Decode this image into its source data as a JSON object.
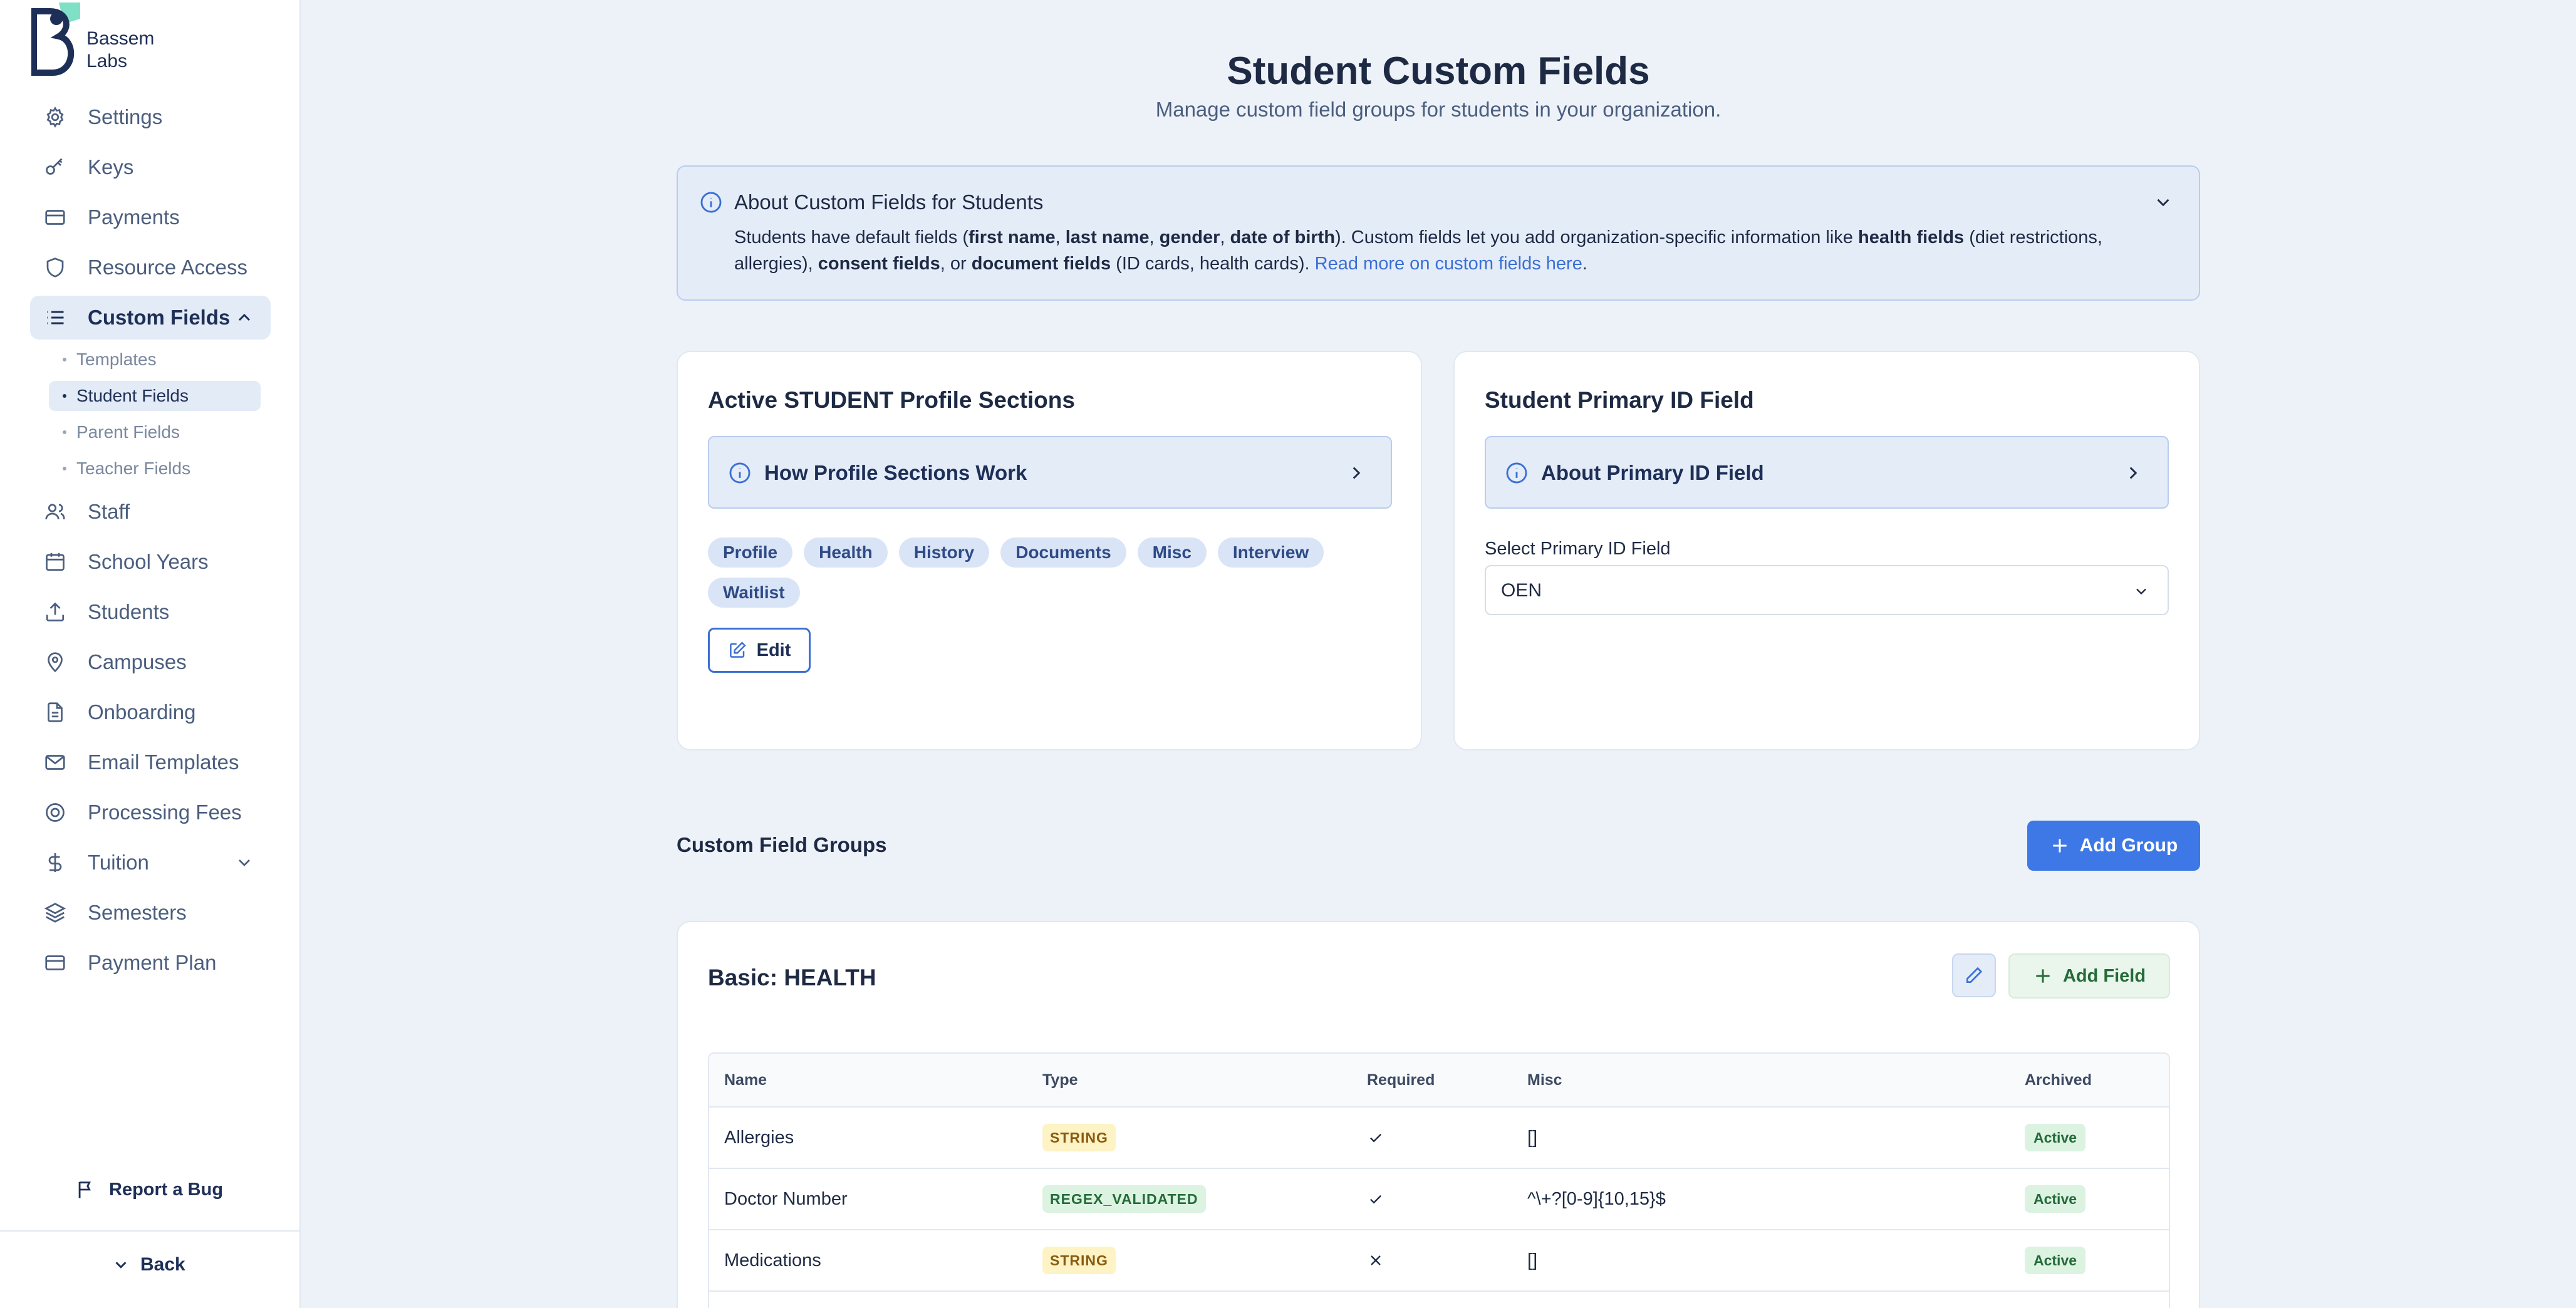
{
  "brand": {
    "logo_line1": "Bassem",
    "logo_line2": "Labs"
  },
  "sidebar": {
    "items": [
      {
        "label": "Settings",
        "icon": "gear-icon"
      },
      {
        "label": "Keys",
        "icon": "key-icon"
      },
      {
        "label": "Payments",
        "icon": "credit-card-icon"
      },
      {
        "label": "Resource Access",
        "icon": "shield-icon"
      },
      {
        "label": "Custom Fields",
        "icon": "list-icon",
        "active": true,
        "expanded": true
      },
      {
        "label": "Staff",
        "icon": "users-icon"
      },
      {
        "label": "School Years",
        "icon": "calendar-icon"
      },
      {
        "label": "Students",
        "icon": "upload-icon"
      },
      {
        "label": "Campuses",
        "icon": "map-pin-icon"
      },
      {
        "label": "Onboarding",
        "icon": "document-icon"
      },
      {
        "label": "Email Templates",
        "icon": "mail-icon"
      },
      {
        "label": "Processing Fees",
        "icon": "circle-dollar-icon"
      },
      {
        "label": "Tuition",
        "icon": "dollar-icon"
      },
      {
        "label": "Semesters",
        "icon": "layers-icon"
      },
      {
        "label": "Payment Plan",
        "icon": "credit-card-icon"
      }
    ],
    "custom_fields_sub": [
      {
        "label": "Templates"
      },
      {
        "label": "Student Fields",
        "active": true
      },
      {
        "label": "Parent Fields"
      },
      {
        "label": "Teacher Fields"
      }
    ],
    "report_bug": "Report a Bug",
    "back": "Back"
  },
  "page": {
    "title": "Student Custom Fields",
    "subtitle": "Manage custom field groups for students in your organization."
  },
  "info_banner": {
    "title": "About Custom Fields for Students",
    "text_parts": [
      "Students have default fields (",
      "first name",
      ", ",
      "last name",
      ", ",
      "gender",
      ", ",
      "date of birth",
      "). Custom fields let you add organization-specific information like ",
      "health fields",
      " (diet restrictions, allergies), ",
      "consent fields",
      ", or ",
      "document fields",
      " (ID cards, health cards). "
    ],
    "link": "Read more on custom fields here",
    "after_link": "."
  },
  "profile_sections": {
    "title": "Active STUDENT Profile Sections",
    "help": "How Profile Sections Work",
    "sections": [
      "Profile",
      "Health",
      "History",
      "Documents",
      "Misc",
      "Interview",
      "Waitlist"
    ],
    "edit_label": "Edit"
  },
  "primary_id": {
    "title": "Student Primary ID Field",
    "help": "About Primary ID Field",
    "select_label": "Select Primary ID Field",
    "selected": "OEN"
  },
  "groups": {
    "label": "Custom Field Groups",
    "add_group_label": "Add Group",
    "group": {
      "title": "Basic: HEALTH",
      "add_field_label": "Add Field",
      "columns": [
        "Name",
        "Type",
        "Required",
        "Misc",
        "Archived"
      ],
      "rows": [
        {
          "name": "Allergies",
          "type": "STRING",
          "required": true,
          "misc": "[]",
          "archived": "Active"
        },
        {
          "name": "Doctor Number",
          "type": "REGEX_VALIDATED",
          "required": true,
          "misc": "^\\+?[0-9]{10,15}$",
          "archived": "Active"
        },
        {
          "name": "Medications",
          "type": "STRING",
          "required": false,
          "misc": "[]",
          "archived": "Active"
        }
      ]
    }
  },
  "colors": {
    "accent": "#3e78e6",
    "navy": "#1e2f57",
    "sidebar_active_bg": "#e3ebf7",
    "info_bg": "#e4ecf8",
    "string_badge_bg": "#fdf3c4",
    "regex_badge_bg": "#dcf3e1",
    "active_badge_bg": "#dcf3e1"
  }
}
